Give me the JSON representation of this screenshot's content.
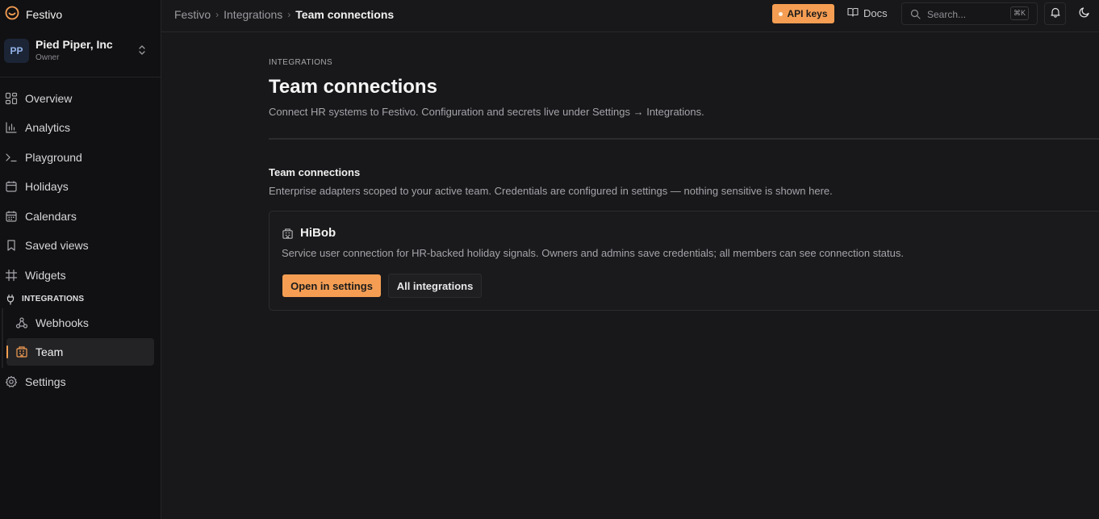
{
  "app": {
    "name": "Festivo",
    "logo_icon": "festivo-logo-icon",
    "accent": "#f59e53"
  },
  "org": {
    "initials": "PP",
    "name": "Pied Piper, Inc",
    "role": "Owner",
    "switch_icon": "chevron-up-down-icon"
  },
  "sidebar": {
    "items": [
      {
        "label": "Overview",
        "icon": "grid-icon"
      },
      {
        "label": "Analytics",
        "icon": "bar-chart-icon"
      },
      {
        "label": "Playground",
        "icon": "terminal-icon"
      },
      {
        "label": "Holidays",
        "icon": "calendar-icon"
      },
      {
        "label": "Calendars",
        "icon": "calendar-days-icon"
      },
      {
        "label": "Saved views",
        "icon": "bookmark-icon"
      },
      {
        "label": "Widgets",
        "icon": "hash-icon"
      }
    ],
    "section": {
      "label": "INTEGRATIONS",
      "icon": "plug-icon"
    },
    "sub_items": [
      {
        "label": "Webhooks",
        "icon": "webhook-icon"
      },
      {
        "label": "Team",
        "icon": "building-icon",
        "active": true
      }
    ],
    "settings": {
      "label": "Settings",
      "icon": "gear-icon"
    }
  },
  "topbar": {
    "breadcrumbs": [
      "Festivo",
      "Integrations",
      "Team connections"
    ],
    "api_keys_label": "API keys",
    "docs_label": "Docs",
    "search_placeholder": "Search...",
    "search_shortcut": "⌘K"
  },
  "main": {
    "eyebrow": "INTEGRATIONS",
    "title": "Team connections",
    "subtitle": "Connect HR systems to Festivo. Configuration and secrets live under Settings → Integrations.",
    "section_title": "Team connections",
    "section_subtitle": "Enterprise adapters scoped to your active team. Credentials are configured in settings — nothing sensitive is shown here.",
    "card": {
      "icon": "building-icon",
      "title": "HiBob",
      "description": "Service user connection for HR-backed holiday signals. Owners and admins save credentials; all members can see connection status.",
      "primary_label": "Open in settings",
      "secondary_label": "All integrations"
    }
  }
}
